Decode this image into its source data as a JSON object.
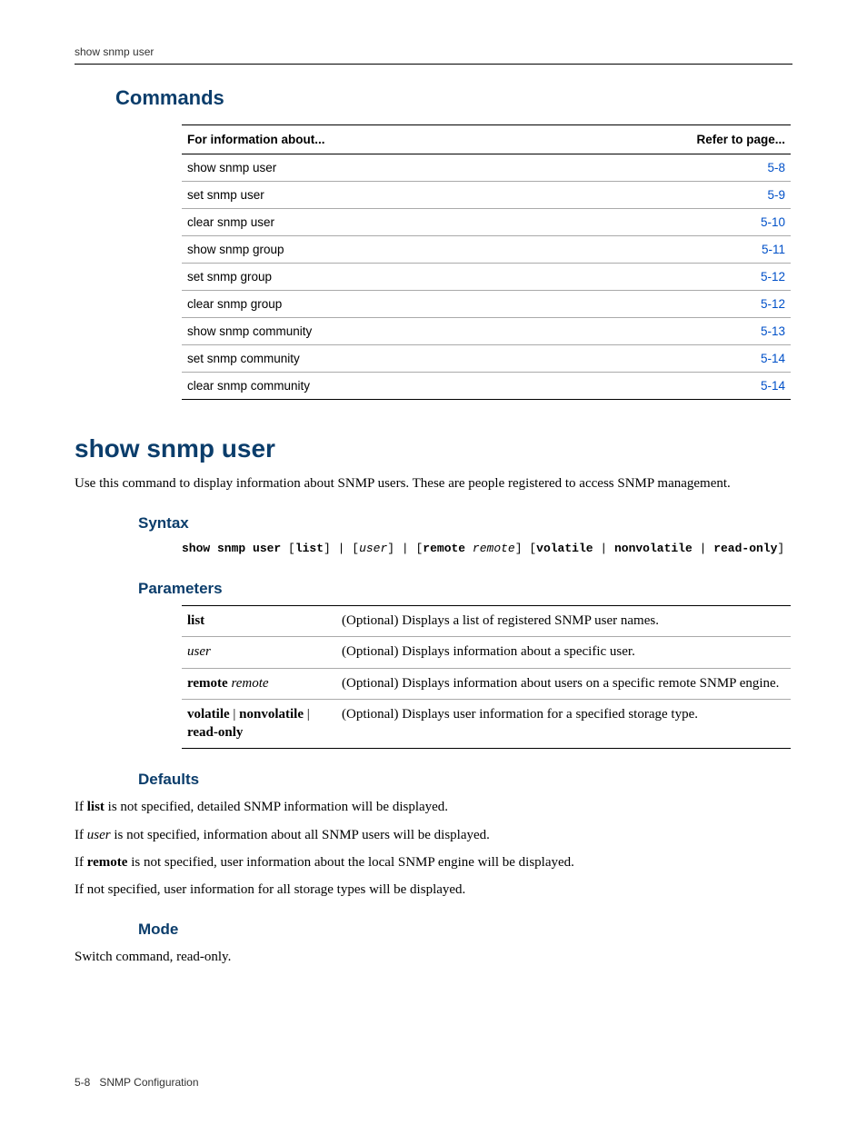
{
  "running_header": "show snmp user",
  "commands_heading": "Commands",
  "commands_table": {
    "head_left": "For information about...",
    "head_right": "Refer to page...",
    "rows": [
      {
        "label": "show snmp user",
        "page": "5-8"
      },
      {
        "label": "set snmp user",
        "page": "5-9"
      },
      {
        "label": "clear snmp user",
        "page": "5-10"
      },
      {
        "label": "show snmp group",
        "page": "5-11"
      },
      {
        "label": "set snmp group",
        "page": "5-12"
      },
      {
        "label": "clear snmp group",
        "page": "5-12"
      },
      {
        "label": "show snmp community",
        "page": "5-13"
      },
      {
        "label": "set snmp community",
        "page": "5-14"
      },
      {
        "label": "clear snmp community",
        "page": "5-14"
      }
    ]
  },
  "cmd": {
    "title": "show snmp user",
    "intro": "Use this command to display information about SNMP users. These are people registered to access SNMP management.",
    "syntax_heading": "Syntax",
    "syntax_parts": {
      "p1": "show snmp user",
      "p2": " [",
      "p3": "list",
      "p4": "] | [",
      "p5": "user",
      "p6": "] | [",
      "p7": "remote",
      "p8": " ",
      "p9": "remote",
      "p10": "] [",
      "p11": "volatile",
      "p12": " | ",
      "p13": "nonvolatile",
      "p14": " | ",
      "p15": "read-only",
      "p16": "]"
    },
    "parameters_heading": "Parameters",
    "params": [
      {
        "name_html": "<span class='serif-b'>list</span>",
        "desc": "(Optional) Displays a list of registered SNMP user names."
      },
      {
        "name_html": "<span class='serif-i'>user</span>",
        "desc": "(Optional) Displays information about a specific user."
      },
      {
        "name_html": "<span class='serif-b'>remote</span> <span class='serif-i'>remote</span>",
        "desc": "(Optional) Displays information about users on a specific remote SNMP engine."
      },
      {
        "name_html": "<span class='serif-b'>volatile</span> | <span class='serif-b'>nonvolatile</span> | <span class='serif-b'>read-only</span>",
        "desc": "(Optional) Displays user information for a specified storage type."
      }
    ],
    "defaults_heading": "Defaults",
    "defaults": [
      {
        "pre": "If ",
        "b": "list",
        "bclass": "serif-b",
        "post": " is not specified, detailed SNMP information will be displayed."
      },
      {
        "pre": "If ",
        "b": "user",
        "bclass": "serif-i",
        "post": " is not specified, information about all SNMP users will be displayed."
      },
      {
        "pre": "If ",
        "b": "remote",
        "bclass": "serif-b",
        "post": " is not specified, user information about the local SNMP engine will be displayed."
      },
      {
        "pre": "",
        "b": "",
        "bclass": "",
        "post": "If not specified, user information for all storage types will be displayed."
      }
    ],
    "mode_heading": "Mode",
    "mode_text": "Switch command, read-only."
  },
  "footer": {
    "page_no": "5-8",
    "section": "SNMP Configuration"
  }
}
